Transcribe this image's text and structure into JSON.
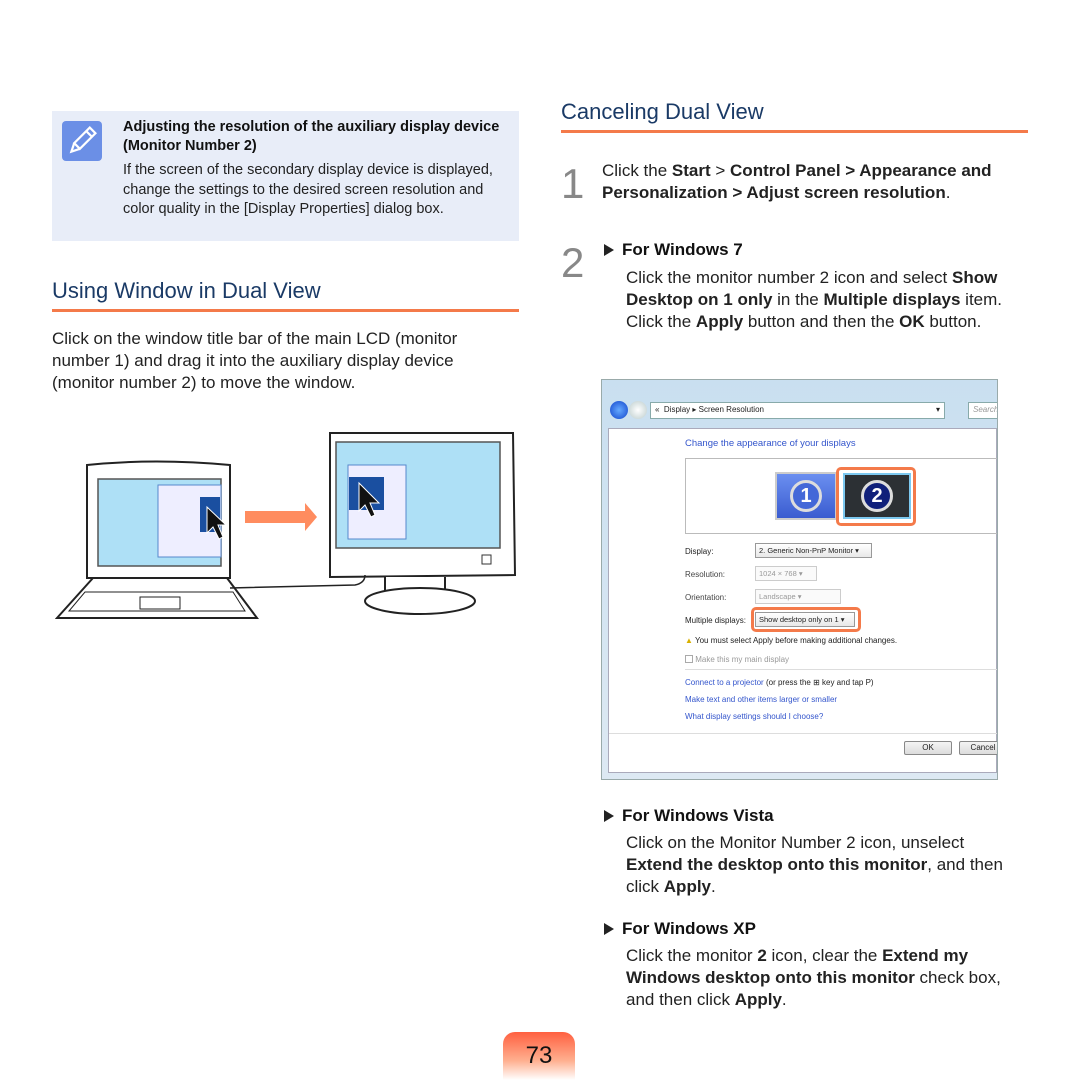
{
  "note": {
    "icon": "pencil-icon",
    "title": "Adjusting the resolution of the auxiliary display device  (Monitor Number 2)",
    "body": "If the screen of the secondary display device is displayed, change the settings to the desired screen resolution and color quality in the [Display Properties] dialog box."
  },
  "left_section": {
    "heading": "Using Window in Dual View",
    "body": "Click on the window title bar of the main LCD (monitor number 1) and drag it into the auxiliary display device (monitor number 2) to move the window."
  },
  "right_section": {
    "heading": "Canceling Dual View",
    "step1": {
      "number": "1",
      "text": [
        {
          "t": "Click the "
        },
        {
          "t": "Start",
          "b": true
        },
        {
          "t": " > "
        },
        {
          "t": "Control Panel > Appearance and Personalization > Adjust screen resolution",
          "b": true
        },
        {
          "t": "."
        }
      ]
    },
    "step2": {
      "number": "2",
      "win7": {
        "title": "For Windows 7",
        "text": [
          {
            "t": "Click the monitor number 2 icon and select "
          },
          {
            "t": "Show Desktop on 1 only",
            "b": true
          },
          {
            "t": " in the "
          },
          {
            "t": "Multiple displays",
            "b": true
          },
          {
            "t": " item. Click the "
          },
          {
            "t": "Apply",
            "b": true
          },
          {
            "t": " button and then the "
          },
          {
            "t": "OK",
            "b": true
          },
          {
            "t": " button."
          }
        ]
      },
      "vista": {
        "title": "For Windows Vista",
        "text": [
          {
            "t": "Click on the Monitor Number 2 icon, unselect "
          },
          {
            "t": "Extend the desktop onto this monitor",
            "b": true
          },
          {
            "t": ", and then click "
          },
          {
            "t": "Apply",
            "b": true
          },
          {
            "t": "."
          }
        ]
      },
      "xp": {
        "title": "For Windows XP",
        "text": [
          {
            "t": "Click the monitor "
          },
          {
            "t": "2",
            "b": true
          },
          {
            "t": " icon, clear the "
          },
          {
            "t": "Extend my Windows desktop onto this monitor",
            "b": true
          },
          {
            "t": " check box, and then click "
          },
          {
            "t": "Apply",
            "b": true
          },
          {
            "t": "."
          }
        ]
      }
    }
  },
  "dialog": {
    "breadcrumb": [
      "«",
      "Display",
      "Screen Resolution"
    ],
    "search_placeholder": "Search",
    "heading": "Change the appearance of your displays",
    "monitors": [
      "1",
      "2"
    ],
    "display_label": "Display:",
    "display_value": "2. Generic Non-PnP Monitor",
    "resolution_label": "Resolution:",
    "resolution_value": "1024 × 768",
    "orientation_label": "Orientation:",
    "orientation_value": "Landscape",
    "multiple_label": "Multiple displays:",
    "multiple_value": "Show desktop only on 1",
    "warning": "You must select Apply before making additional changes.",
    "main_display": "Make this my main display",
    "link1": "Connect to a projector",
    "link1_suffix": "(or press the ⊞ key and tap P)",
    "link2": "Make text and other items larger or smaller",
    "link3": "What display settings should I choose?",
    "ok": "OK",
    "cancel": "Cancel",
    "highlight_color": "#f47a4a"
  },
  "page_number": "73"
}
